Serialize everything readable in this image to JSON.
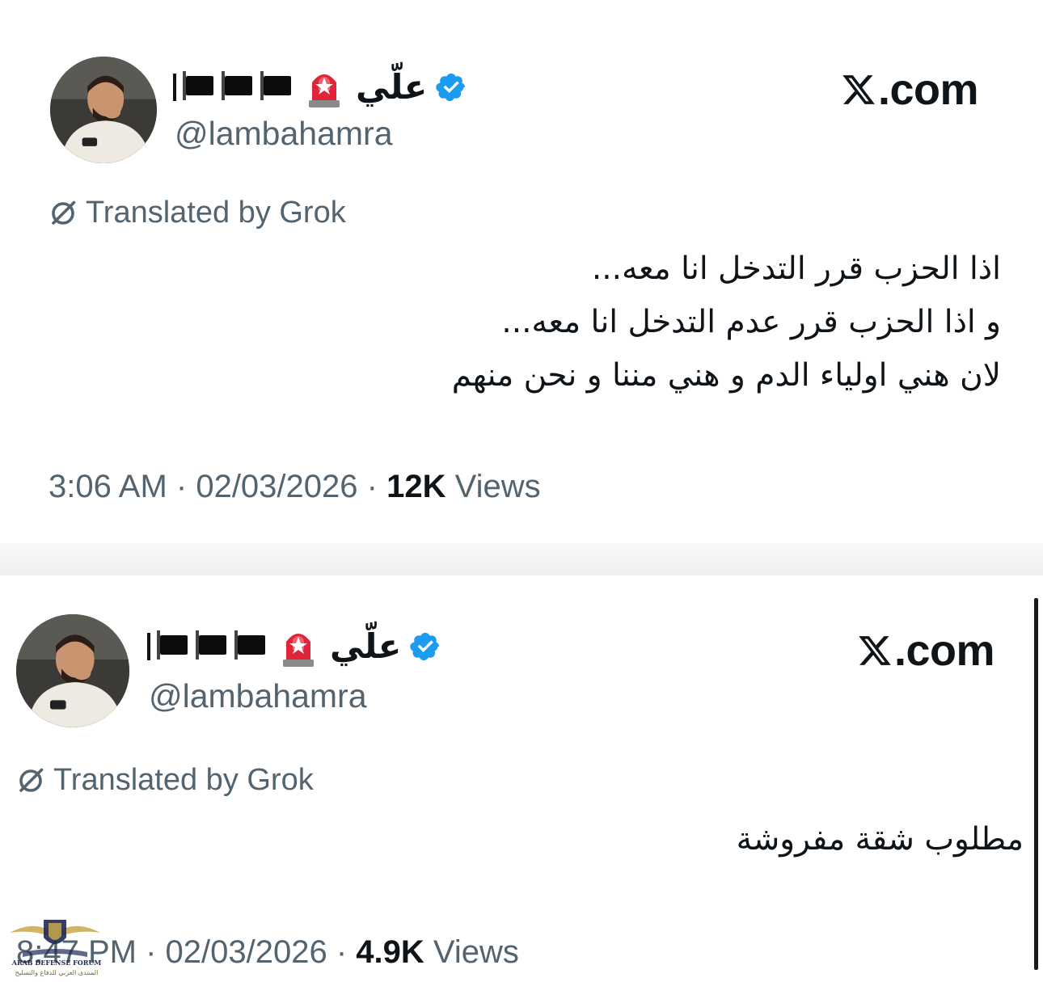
{
  "tweets": [
    {
      "display_name": "علّي",
      "handle": "@lambahamra",
      "site": ".com",
      "translated_label": "Translated by Grok",
      "text_lines": [
        "اذا الحزب قرر التدخل انا معه...",
        "و اذا الحزب قرر عدم التدخل انا معه...",
        "لان هني اولياء الدم و هني مننا و نحن منهم"
      ],
      "time": "3:06 AM",
      "date": "02/03/2026",
      "views_count": "12K",
      "views_label": "Views"
    },
    {
      "display_name": "علّي",
      "handle": "@lambahamra",
      "site": ".com",
      "translated_label": "Translated by Grok",
      "text_lines": [
        "مطلوب شقة مفروشة"
      ],
      "time": "8:47 PM",
      "date": "02/03/2026",
      "views_count": "4.9K",
      "views_label": "Views"
    }
  ],
  "watermark": {
    "title": "ARAB DEFENSE FORUM",
    "subtitle": "المنتدى العربي للدفاع والتسليح"
  },
  "colors": {
    "verified": "#1d9bf0",
    "muted_text": "#536471",
    "primary_text": "#0f1419",
    "siren_red": "#e0243a"
  }
}
